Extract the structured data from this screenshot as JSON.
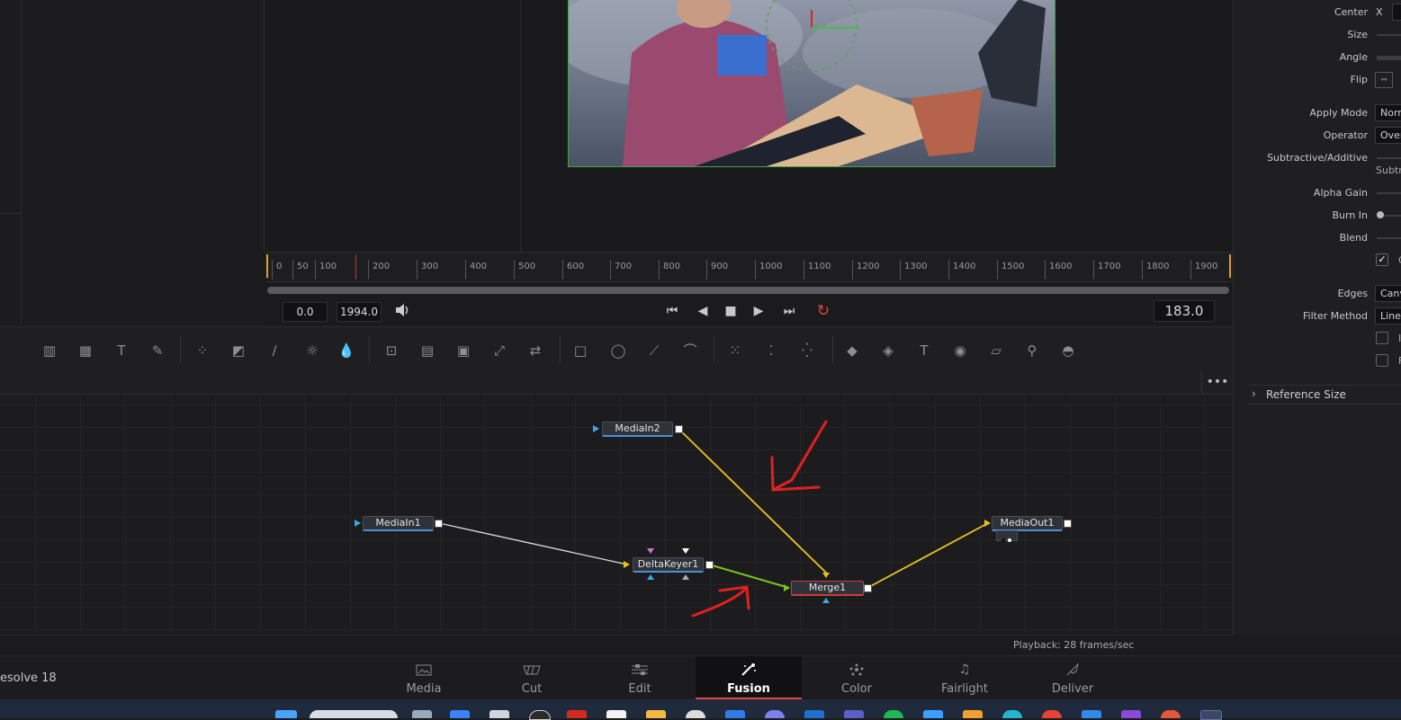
{
  "timeline": {
    "ticks": [
      "0",
      "50",
      "100",
      "200",
      "300",
      "400",
      "500",
      "600",
      "700",
      "800",
      "900",
      "1000",
      "1100",
      "1200",
      "1300",
      "1400",
      "1500",
      "1600",
      "1700",
      "1800",
      "1900"
    ],
    "start_value": "0.0",
    "end_value": "1994.0",
    "current_frame": "183.0"
  },
  "transport": {
    "volume_icon": "speaker-icon",
    "first": "⏮",
    "prev": "◀",
    "stop": "■",
    "play": "▶",
    "last": "⏭",
    "loop": "↻"
  },
  "toolbar": {
    "tools": [
      "▥",
      "▦",
      "T",
      "✎",
      "⁘",
      "◩",
      "∕",
      "☼",
      "💧",
      "⊡",
      "▤",
      "▣",
      "⤢",
      "⇄",
      "□",
      "◯",
      "⟋",
      "⌒",
      "⁙",
      "⁚",
      "⁛",
      "◆",
      "◈",
      "T",
      "◉",
      "▱",
      "⚲",
      "◓"
    ]
  },
  "node_editor": {
    "more_label": "•••",
    "nodes": {
      "mediain2": "MediaIn2",
      "mediain1": "MediaIn1",
      "deltakeyer1": "DeltaKeyer1",
      "merge1": "Merge1",
      "mediaout1": "MediaOut1"
    },
    "annotation_color": "#e0211f",
    "link_yellow": "#e8c21f",
    "link_green": "#7cc21f",
    "link_white": "#dddddd"
  },
  "status": {
    "playback": "Playback: 28 frames/sec"
  },
  "pagebar": {
    "app_name": "esolve 18",
    "tabs": [
      {
        "label": "Media",
        "icon": "media-icon"
      },
      {
        "label": "Cut",
        "icon": "cut-icon"
      },
      {
        "label": "Edit",
        "icon": "edit-icon"
      },
      {
        "label": "Fusion",
        "icon": "fusion-icon"
      },
      {
        "label": "Color",
        "icon": "color-icon"
      },
      {
        "label": "Fairlight",
        "icon": "fairlight-icon"
      },
      {
        "label": "Deliver",
        "icon": "deliver-icon"
      }
    ],
    "active_tab": "Fusion"
  },
  "inspector": {
    "center_label": "Center",
    "center_x_label": "X",
    "size_label": "Size",
    "angle_label": "Angle",
    "flip_label": "Flip",
    "apply_mode_label": "Apply Mode",
    "apply_mode_value": "Norm",
    "operator_label": "Operator",
    "operator_value": "Over",
    "subtractive_label": "Subtractive/Additive",
    "subtractive_value": "Subtra",
    "alpha_gain_label": "Alpha Gain",
    "burn_in_label": "Burn In",
    "blend_label": "Blend",
    "check_text": "C",
    "edges_label": "Edges",
    "edges_value": "Canv",
    "filter_label": "Filter Method",
    "filter_value": "Line",
    "check2_text": "I",
    "check3_text": "F",
    "reference_size": "Reference Size"
  }
}
